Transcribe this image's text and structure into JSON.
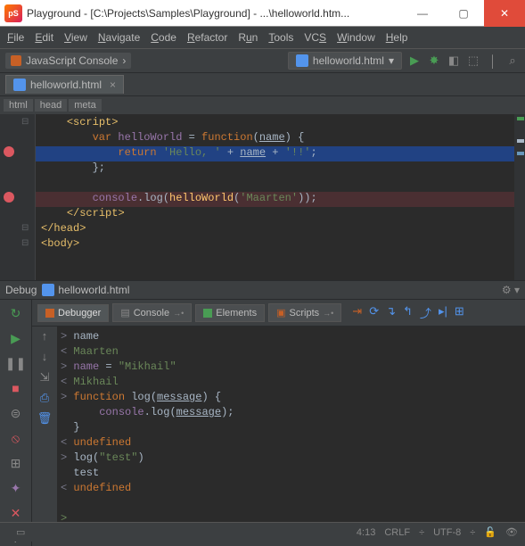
{
  "titlebar": {
    "app": "pS",
    "title": "Playground - [C:\\Projects\\Samples\\Playground] - ...\\helloworld.htm..."
  },
  "menu": {
    "file": "File",
    "edit": "Edit",
    "view": "View",
    "navigate": "Navigate",
    "code": "Code",
    "refactor": "Refactor",
    "run": "Run",
    "tools": "Tools",
    "vcs": "VCS",
    "window": "Window",
    "help": "Help"
  },
  "navbar": {
    "js_console": "JavaScript Console",
    "arrow": "›",
    "runfile": "helloworld.html"
  },
  "tab": {
    "name": "helloworld.html"
  },
  "breadcrumb": {
    "a": "html",
    "b": "head",
    "c": "meta"
  },
  "code": {
    "l1a": "<",
    "l1b": "script",
    "l1c": ">",
    "l2a": "var ",
    "l2b": "helloWorld",
    "l2c": " = ",
    "l2d": "function",
    "l2e": "(",
    "l2f": "name",
    "l2g": ") {",
    "l3a": "return ",
    "l3b": "'Hello, '",
    "l3c": " + ",
    "l3d": "name",
    "l3e": " + ",
    "l3f": "'!!'",
    "l3g": ";",
    "l4": "};",
    "l5": "",
    "l6a": "console",
    "l6b": ".log(",
    "l6c": "helloWorld",
    "l6d": "(",
    "l6e": "'Maarten'",
    "l6f": "));",
    "l7a": "</",
    "l7b": "script",
    "l7c": ">",
    "l8a": "</",
    "l8b": "head",
    "l8c": ">",
    "l9a": "<",
    "l9b": "body",
    "l9c": ">"
  },
  "debug": {
    "label": "Debug",
    "filename": "helloworld.html"
  },
  "dtabs": {
    "debugger": "Debugger",
    "console": "Console",
    "elements": "Elements",
    "scripts": "Scripts"
  },
  "console": {
    "l1": "name",
    "l2": "Maarten",
    "l3a": "name",
    "l3b": " = ",
    "l3c": "\"Mikhail\"",
    "l4": "Mikhail",
    "l5a": "function ",
    "l5b": "log",
    "l5c": "(",
    "l5d": "message",
    "l5e": ") {",
    "l6a": "console",
    "l6b": ".log(",
    "l6c": "message",
    "l6d": ");",
    "l7": "}",
    "l8": "undefined",
    "l9a": "log",
    "l9b": "(",
    "l9c": "\"test\"",
    "l9d": ")",
    "l10": "test",
    "l11": "undefined"
  },
  "status": {
    "pos": "4:13",
    "eol": "CRLF",
    "sep": "÷",
    "enc": "UTF-8"
  }
}
